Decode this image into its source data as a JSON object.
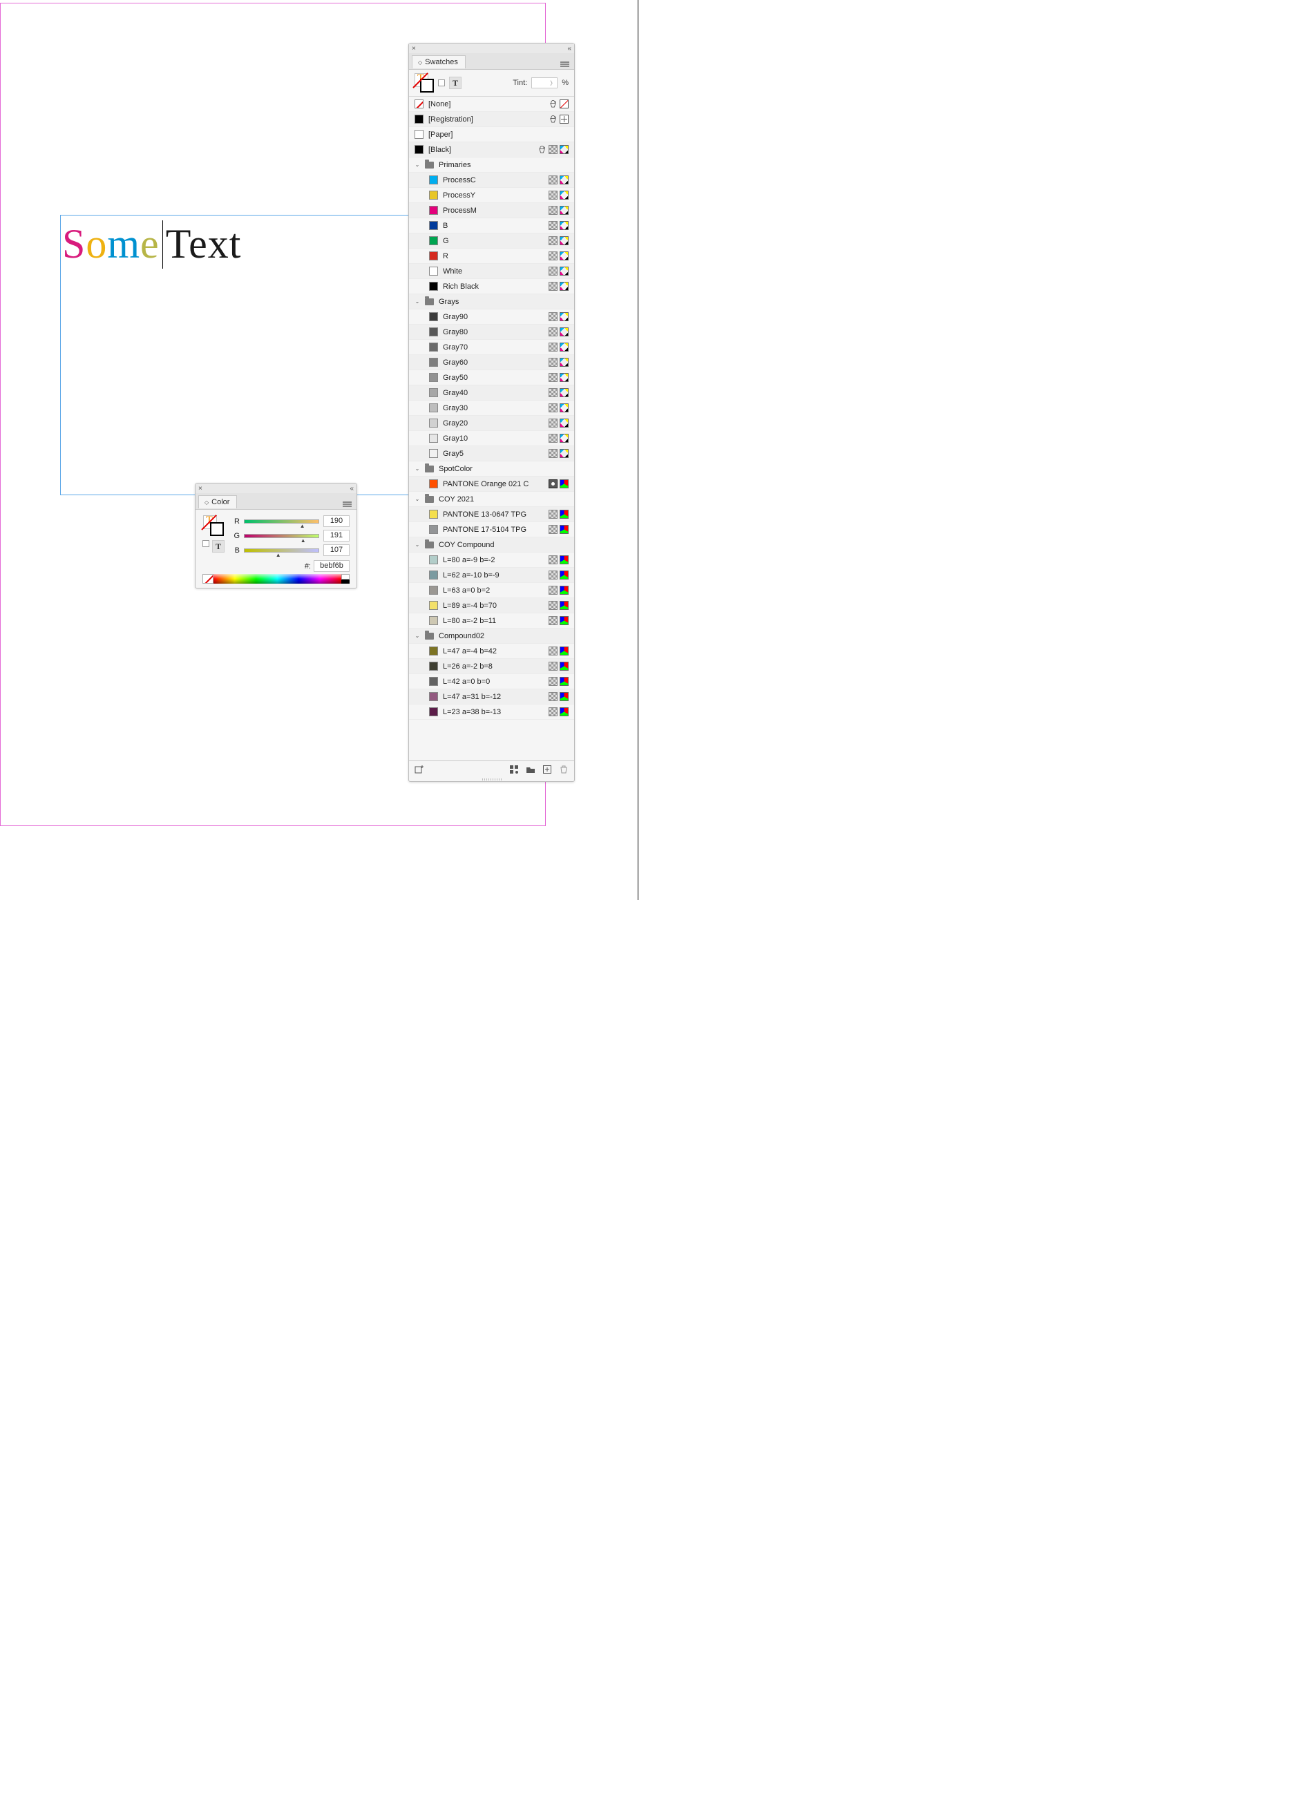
{
  "canvas_text": {
    "chars": [
      {
        "c": "S",
        "color": "#d81b7d"
      },
      {
        "c": "o",
        "color": "#eeb111"
      },
      {
        "c": "m",
        "color": "#0091d0"
      },
      {
        "c": "e",
        "color": "#b7b547"
      }
    ],
    "rest": "Text",
    "rest_color": "#1a1a1a"
  },
  "swatches_panel": {
    "tab": "Swatches",
    "tint_label": "Tint:",
    "tint_suffix": "%",
    "footer_icons": [
      "add-from-color",
      "new-group",
      "new-folder",
      "new-swatch",
      "trash"
    ],
    "rows": [
      {
        "kind": "swatch",
        "indent": 0,
        "name": "[None]",
        "color": "none",
        "icons": [
          "lock",
          "none"
        ]
      },
      {
        "kind": "swatch",
        "indent": 0,
        "name": "[Registration]",
        "color": "#000000",
        "icons": [
          "lock",
          "reg"
        ]
      },
      {
        "kind": "swatch",
        "indent": 0,
        "name": "[Paper]",
        "color": "#ffffff",
        "icons": []
      },
      {
        "kind": "swatch",
        "indent": 0,
        "name": "[Black]",
        "color": "#000000",
        "icons": [
          "lock",
          "gray",
          "cmyk"
        ]
      },
      {
        "kind": "group",
        "indent": 0,
        "name": "Primaries"
      },
      {
        "kind": "swatch",
        "indent": 1,
        "name": "ProcessC",
        "color": "#00aeef",
        "icons": [
          "gray",
          "cmyk"
        ]
      },
      {
        "kind": "swatch",
        "indent": 1,
        "name": "ProcessY",
        "color": "#e8c627",
        "icons": [
          "gray",
          "cmyk"
        ]
      },
      {
        "kind": "swatch",
        "indent": 1,
        "name": "ProcessM",
        "color": "#e3007b",
        "icons": [
          "gray",
          "cmyk"
        ]
      },
      {
        "kind": "swatch",
        "indent": 1,
        "name": "B",
        "color": "#003a9b",
        "icons": [
          "gray",
          "cmyk"
        ]
      },
      {
        "kind": "swatch",
        "indent": 1,
        "name": "G",
        "color": "#00a551",
        "icons": [
          "gray",
          "cmyk"
        ]
      },
      {
        "kind": "swatch",
        "indent": 1,
        "name": "R",
        "color": "#d42a1f",
        "icons": [
          "gray",
          "cmyk"
        ]
      },
      {
        "kind": "swatch",
        "indent": 1,
        "name": "White",
        "color": "#ffffff",
        "icons": [
          "gray",
          "cmyk"
        ]
      },
      {
        "kind": "swatch",
        "indent": 1,
        "name": "Rich Black",
        "color": "#000000",
        "icons": [
          "gray",
          "cmyk"
        ]
      },
      {
        "kind": "group",
        "indent": 0,
        "name": "Grays"
      },
      {
        "kind": "swatch",
        "indent": 1,
        "name": "Gray90",
        "color": "#3c3c3c",
        "icons": [
          "gray",
          "cmyk"
        ]
      },
      {
        "kind": "swatch",
        "indent": 1,
        "name": "Gray80",
        "color": "#575757",
        "icons": [
          "gray",
          "cmyk"
        ]
      },
      {
        "kind": "swatch",
        "indent": 1,
        "name": "Gray70",
        "color": "#6b6b6b",
        "icons": [
          "gray",
          "cmyk"
        ]
      },
      {
        "kind": "swatch",
        "indent": 1,
        "name": "Gray60",
        "color": "#7e7e7e",
        "icons": [
          "gray",
          "cmyk"
        ]
      },
      {
        "kind": "swatch",
        "indent": 1,
        "name": "Gray50",
        "color": "#939393",
        "icons": [
          "gray",
          "cmyk"
        ]
      },
      {
        "kind": "swatch",
        "indent": 1,
        "name": "Gray40",
        "color": "#a7a7a7",
        "icons": [
          "gray",
          "cmyk"
        ]
      },
      {
        "kind": "swatch",
        "indent": 1,
        "name": "Gray30",
        "color": "#bdbdbd",
        "icons": [
          "gray",
          "cmyk"
        ]
      },
      {
        "kind": "swatch",
        "indent": 1,
        "name": "Gray20",
        "color": "#d1d1d1",
        "icons": [
          "gray",
          "cmyk"
        ]
      },
      {
        "kind": "swatch",
        "indent": 1,
        "name": "Gray10",
        "color": "#e6e6e6",
        "icons": [
          "gray",
          "cmyk"
        ]
      },
      {
        "kind": "swatch",
        "indent": 1,
        "name": "Gray5",
        "color": "#f1f1f1",
        "icons": [
          "gray",
          "cmyk"
        ]
      },
      {
        "kind": "group",
        "indent": 0,
        "name": "SpotColor"
      },
      {
        "kind": "swatch",
        "indent": 1,
        "name": "PANTONE Orange 021 C",
        "color": "#ff5000",
        "icons": [
          "spot",
          "rgb"
        ]
      },
      {
        "kind": "group",
        "indent": 0,
        "name": "COY 2021"
      },
      {
        "kind": "swatch",
        "indent": 1,
        "name": "PANTONE 13-0647 TPG",
        "color": "#f5df4d",
        "icons": [
          "gray",
          "rgb"
        ]
      },
      {
        "kind": "swatch",
        "indent": 1,
        "name": "PANTONE 17-5104 TPG",
        "color": "#939597",
        "icons": [
          "gray",
          "rgb"
        ]
      },
      {
        "kind": "group",
        "indent": 0,
        "name": "COY Compound"
      },
      {
        "kind": "swatch",
        "indent": 1,
        "name": "L=80 a=-9 b=-2",
        "color": "#b2cdc9",
        "icons": [
          "gray",
          "rgb"
        ]
      },
      {
        "kind": "swatch",
        "indent": 1,
        "name": "L=62 a=-10 b=-9",
        "color": "#7b9aa0",
        "icons": [
          "gray",
          "rgb"
        ]
      },
      {
        "kind": "swatch",
        "indent": 1,
        "name": "L=63 a=0 b=2",
        "color": "#9b9893",
        "icons": [
          "gray",
          "rgb"
        ]
      },
      {
        "kind": "swatch",
        "indent": 1,
        "name": "L=89 a=-4 b=70",
        "color": "#f3e06a",
        "icons": [
          "gray",
          "rgb"
        ]
      },
      {
        "kind": "swatch",
        "indent": 1,
        "name": "L=80 a=-2 b=11",
        "color": "#cec8b3",
        "icons": [
          "gray",
          "rgb"
        ]
      },
      {
        "kind": "group",
        "indent": 0,
        "name": "Compound02"
      },
      {
        "kind": "swatch",
        "indent": 1,
        "name": "L=47 a=-4 b=42",
        "color": "#7c7323",
        "icons": [
          "gray",
          "rgb"
        ]
      },
      {
        "kind": "swatch",
        "indent": 1,
        "name": "L=26 a=-2 b=8",
        "color": "#3f3f32",
        "icons": [
          "gray",
          "rgb"
        ]
      },
      {
        "kind": "swatch",
        "indent": 1,
        "name": "L=42 a=0 b=0",
        "color": "#636363",
        "icons": [
          "gray",
          "rgb"
        ]
      },
      {
        "kind": "swatch",
        "indent": 1,
        "name": "L=47 a=31 b=-12",
        "color": "#935980",
        "icons": [
          "gray",
          "rgb"
        ]
      },
      {
        "kind": "swatch",
        "indent": 1,
        "name": "L=23 a=38 b=-13",
        "color": "#5b1c48",
        "icons": [
          "gray",
          "rgb"
        ]
      }
    ]
  },
  "color_panel": {
    "tab": "Color",
    "channels": [
      {
        "label": "R",
        "value": "190",
        "grad": "linear-gradient(to right,#00bf6b,#ffbf6b)",
        "pos": 74
      },
      {
        "label": "G",
        "value": "191",
        "grad": "linear-gradient(to right,#be006b,#beff6b)",
        "pos": 75
      },
      {
        "label": "B",
        "value": "107",
        "grad": "linear-gradient(to right,#bebf00,#bebfff)",
        "pos": 42
      }
    ],
    "hex_label": "#:",
    "hex": "bebf6b"
  }
}
